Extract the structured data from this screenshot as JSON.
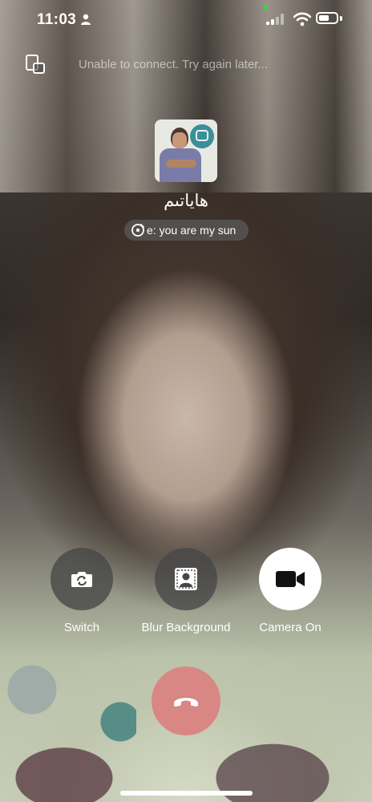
{
  "status_bar": {
    "time": "11:03"
  },
  "header": {
    "notice": "Unable to connect. Try again later..."
  },
  "contact": {
    "name": "هاياتىم"
  },
  "song": {
    "text": "e:  you are my sun"
  },
  "controls": [
    {
      "label": "Switch",
      "icon": "camera-switch-icon"
    },
    {
      "label": "Blur Background",
      "icon": "blur-background-icon"
    },
    {
      "label": "Camera On",
      "icon": "video-camera-icon"
    }
  ],
  "end_call": {
    "icon": "end-call-icon",
    "color": "#d98784"
  },
  "battery_level": 0.6
}
